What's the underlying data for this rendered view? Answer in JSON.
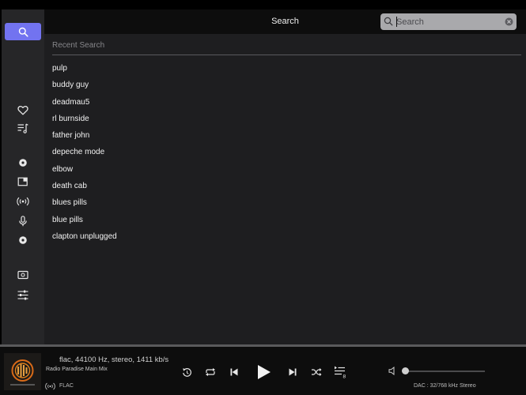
{
  "header": {
    "title": "Search"
  },
  "search": {
    "placeholder": "Search",
    "value": ""
  },
  "recent": {
    "label": "Recent Search",
    "items": [
      "pulp",
      "buddy guy",
      "deadmau5",
      "rl burnside",
      "father john",
      "depeche mode",
      "elbow",
      "death cab",
      "blues pills",
      "blue pills",
      "clapton unplugged"
    ]
  },
  "sidebar": {
    "items": [
      {
        "name": "search",
        "icon": "search-icon",
        "active": true
      },
      {
        "name": "favorites",
        "icon": "heart-icon"
      },
      {
        "name": "playlists",
        "icon": "playlist-icon"
      },
      {
        "name": "local-library",
        "icon": "disc-icon"
      },
      {
        "name": "library",
        "icon": "library-icon"
      },
      {
        "name": "radio",
        "icon": "radio-icon"
      },
      {
        "name": "podcasts",
        "icon": "microphone-icon"
      },
      {
        "name": "streaming-service",
        "icon": "disc-icon"
      },
      {
        "name": "display",
        "icon": "screen-icon"
      },
      {
        "name": "settings",
        "icon": "sliders-icon"
      }
    ]
  },
  "player": {
    "format": "flac, 44100 Hz, stereo, 1411 kb/s",
    "station": "Radio Paradise Main Mix",
    "codec": "FLAC",
    "dac": "DAC : 32/768 kHz Stereo",
    "queue_count": "8",
    "volume": 0
  },
  "colors": {
    "accent": "#7273f0",
    "sidebar_bg": "#262628",
    "content_bg": "#1e1e20",
    "bar_bg": "#0d0d0d"
  }
}
